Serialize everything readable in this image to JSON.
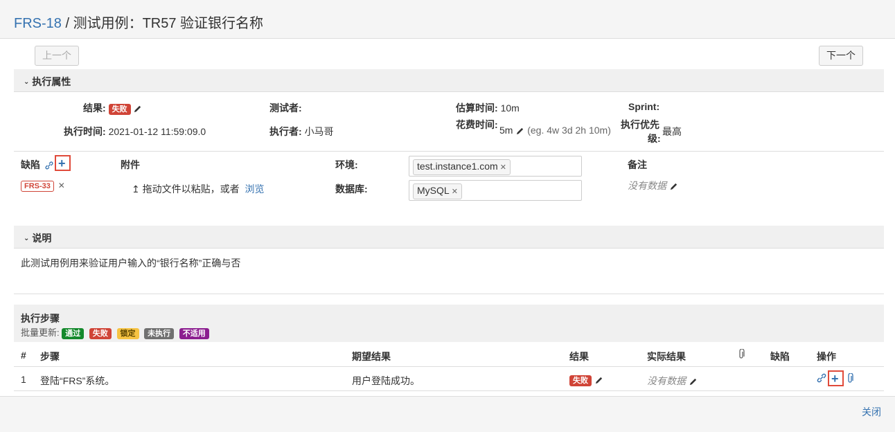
{
  "header": {
    "issue_key": "FRS-18",
    "separator": " / ",
    "title": "测试用例：TR57 验证银行名称"
  },
  "nav": {
    "prev_label": "上一个",
    "next_label": "下一个"
  },
  "exec_props": {
    "section_title": "执行属性",
    "result_label": "结果:",
    "result_value": "失败",
    "tester_label": "测试者:",
    "estimate_label": "估算时间:",
    "estimate_value": "10m",
    "sprint_label": "Sprint:",
    "exec_time_label": "执行时间:",
    "exec_time_value": "2021-01-12 11:59:09.0",
    "executor_label": "执行者:",
    "executor_value": "小马哥",
    "spent_label": "花费时间:",
    "spent_value": "5m",
    "spent_hint": "(eg. 4w 3d 2h 10m)",
    "priority_label_1": "执行优先",
    "priority_label_2": "级:",
    "priority_value": "最高"
  },
  "details": {
    "defects_label": "缺陷",
    "defect_badge": "FRS-33",
    "attachments_label": "附件",
    "drop_text": "拖动文件以粘贴，或者",
    "browse_link": "浏览",
    "env_label": "环境:",
    "env_value": "test.instance1.com",
    "db_label": "数据库:",
    "db_value": "MySQL",
    "notes_label": "备注",
    "notes_value": "没有数据"
  },
  "description": {
    "section_title": "说明",
    "text": "此测试用例用来验证用户输入的“银行名称”正确与否"
  },
  "steps": {
    "section_title": "执行步骤",
    "bulk_label": "批量更新:",
    "bulk_buttons": [
      "通过",
      "失败",
      "锁定",
      "未执行",
      "不适用"
    ],
    "columns": [
      "#",
      "步骤",
      "期望结果",
      "结果",
      "实际结果",
      "缺陷",
      "操作"
    ],
    "rows": [
      {
        "num": "1",
        "step": "登陆“FRS”系统。",
        "expected": "用户登陆成功。",
        "result": "失败",
        "actual": "没有数据"
      }
    ]
  },
  "footer": {
    "close_label": "关闭"
  },
  "colors": {
    "accent": "#3572b0",
    "fail": "#d04437",
    "pass": "#14892c",
    "blocked": "#f6c342",
    "unexecuted": "#707070",
    "na": "#8b1d8f",
    "highlight": "#e04a3a"
  },
  "icons": [
    "chevron-down-icon",
    "pencil-icon",
    "link-icon",
    "plus-icon",
    "remove-icon",
    "upload-icon",
    "paperclip-icon"
  ]
}
